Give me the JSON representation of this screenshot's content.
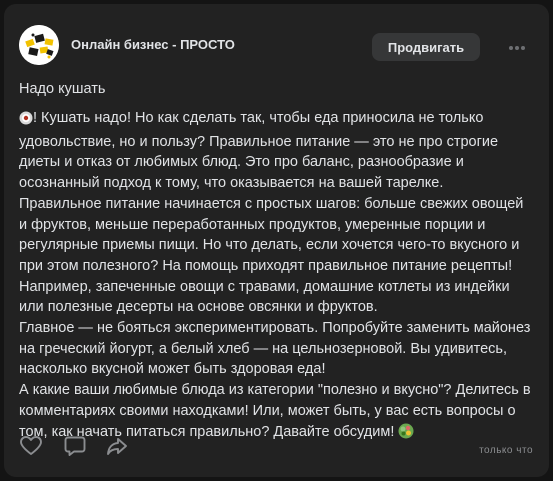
{
  "post": {
    "group_name": "Онлайн бизнес - ПРОСТО",
    "promote_button": "Продвигать",
    "title": "Надо кушать",
    "paragraphs": [
      {
        "emoji": "plate-icon",
        "text": "! Кушать надо! Но как сделать так, чтобы еда приносила не только удовольствие, но и пользу? Правильное питание — это не про строгие диеты и отказ от любимых блюд. Это про баланс, разнообразие и осознанный подход к тому, что оказывается на вашей тарелке."
      },
      {
        "text": "Правильное питание начинается с простых шагов: больше свежих овощей и фруктов, меньше переработанных продуктов, умеренные порции и регулярные приемы пищи. Но что делать, если хочется чего-то вкусного и при этом полезного? На помощь приходят правильное питание рецепты! Например, запеченные овощи с травами, домашние котлеты из индейки или полезные десерты на основе овсянки и фруктов."
      },
      {
        "text": "Главное — не бояться экспериментировать. Попробуйте заменить майонез на греческий йогурт, а белый хлеб — на цельнозерновой. Вы удивитесь, насколько вкусной может быть здоровая еда!"
      },
      {
        "text": "А какие ваши любимые блюда из категории \"полезно и вкусно\"? Делитесь в комментариях своими находками! Или, может быть, у вас есть вопросы о том, как начать питаться правильно? Давайте обсудим!",
        "emoji_after": "salad-icon"
      }
    ],
    "footer_label": "только что"
  },
  "colors": {
    "page_bg": "#141414",
    "card_bg": "#222222",
    "text": "#e1e3e6",
    "muted": "#8b8d90",
    "button_bg": "#363738"
  }
}
